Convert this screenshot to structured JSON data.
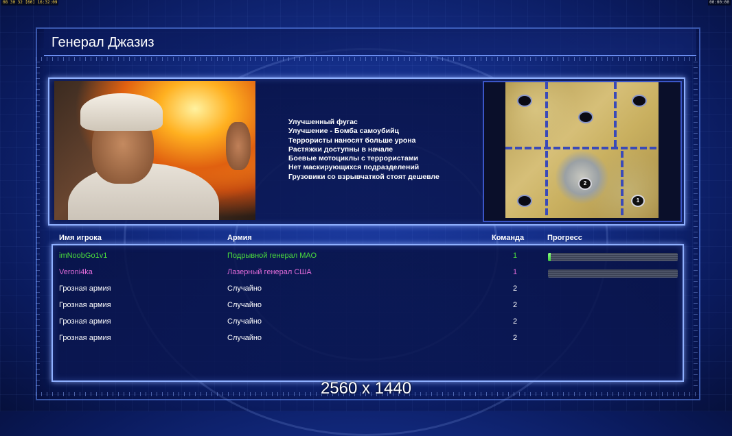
{
  "hud": {
    "left_readout": "08 30 32 [60] 16:32:09",
    "right_readout": "00:00:00"
  },
  "header": {
    "title": "Генерал Джазиз"
  },
  "general": {
    "bonuses": [
      "Улучшенный фугас",
      "Улучшение - Бомба самоубийц",
      "Террористы наносят больше урона",
      "Растяжки доступны в начале",
      "Боевые мотоциклы с террористами",
      "Нет маскирующихся подразделений",
      "Грузовики со взрывчаткой стоят дешевле"
    ]
  },
  "map": {
    "slot_labels": [
      "2",
      "1"
    ]
  },
  "players_table": {
    "headers": {
      "name": "Имя игрока",
      "army": "Армия",
      "team": "Команда",
      "progress": "Прогресс"
    },
    "rows": [
      {
        "name": "imNoobGo1v1",
        "army": "Подрывной генерал МАО",
        "team": "1",
        "color": "#4be03c",
        "progress": 0.02
      },
      {
        "name": "Veroni4ka",
        "army": "Лазерный генерал США",
        "team": "1",
        "color": "#e06bd8",
        "progress": 0
      },
      {
        "name": "Грозная армия",
        "army": "Случайно",
        "team": "2",
        "color": "#ffffff"
      },
      {
        "name": "Грозная армия",
        "army": "Случайно",
        "team": "2",
        "color": "#ffffff"
      },
      {
        "name": "Грозная армия",
        "army": "Случайно",
        "team": "2",
        "color": "#ffffff"
      },
      {
        "name": "Грозная армия",
        "army": "Случайно",
        "team": "2",
        "color": "#ffffff"
      }
    ]
  },
  "footer": {
    "resolution": "2560 x 1440"
  }
}
